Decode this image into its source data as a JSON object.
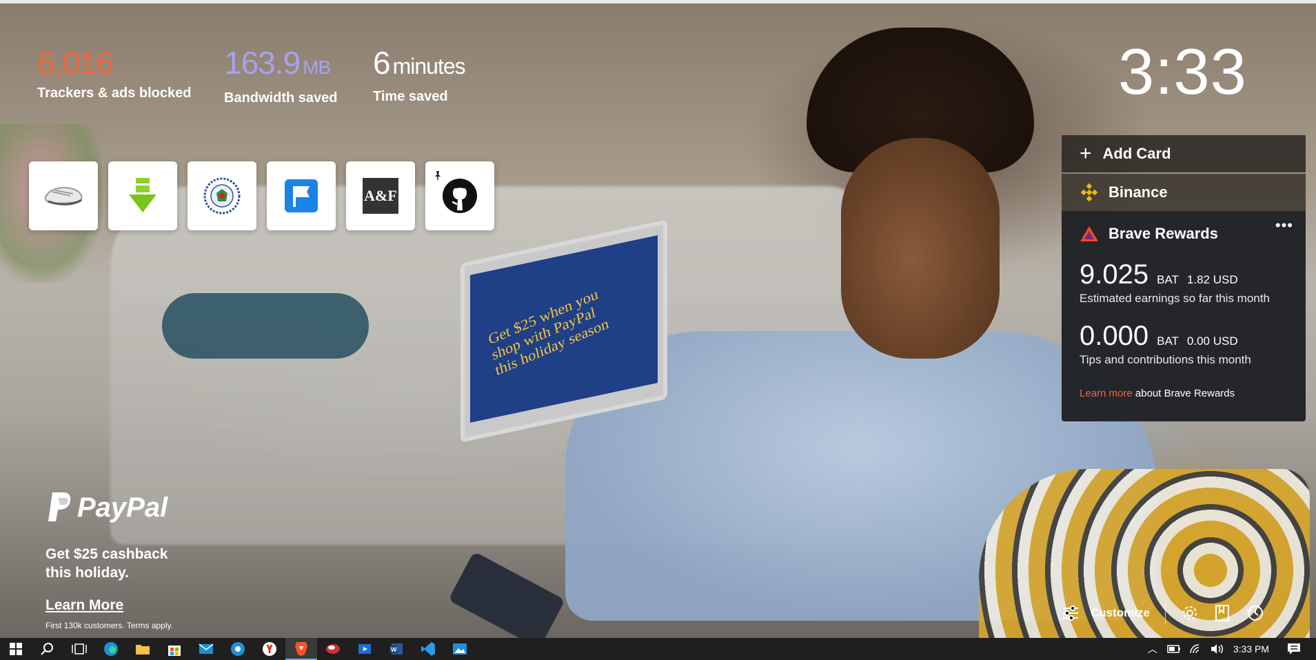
{
  "stats": {
    "trackers_value": "6,016",
    "trackers_label": "Trackers & ads blocked",
    "bandwidth_value": "163.9",
    "bandwidth_unit": "MB",
    "bandwidth_label": "Bandwidth saved",
    "time_value": "6",
    "time_unit": "minutes",
    "time_label": "Time saved"
  },
  "colors": {
    "trackers": "#f2643d",
    "bandwidth": "#a9a1ee",
    "learn_more": "#f2643d",
    "binance": "#f0b90b"
  },
  "top_sites": [
    {
      "icon": "shoe-icon"
    },
    {
      "icon": "download-arrow-icon"
    },
    {
      "icon": "coat-of-arms-icon"
    },
    {
      "icon": "flag-icon"
    },
    {
      "icon": "af-logo-icon",
      "text": "A&F"
    },
    {
      "icon": "github-icon"
    }
  ],
  "clock": "3:33",
  "cards": {
    "add_card": "Add Card",
    "binance": "Binance"
  },
  "rewards": {
    "title": "Brave Rewards",
    "earnings_amount": "9.025",
    "earnings_currency": "BAT",
    "earnings_usd": "1.82 USD",
    "earnings_desc": "Estimated earnings so far this month",
    "tips_amount": "0.000",
    "tips_currency": "BAT",
    "tips_usd": "0.00 USD",
    "tips_desc": "Tips and contributions this month",
    "learn_more": "Learn more",
    "learn_more_suffix": "about Brave Rewards"
  },
  "ad": {
    "brand": "PayPal",
    "headline_line1": "Get $25 cashback",
    "headline_line2": "this holiday.",
    "cta": "Learn More",
    "fineprint": "First 130k customers. Terms apply."
  },
  "photo": {
    "laptop_line1": "Get $25 when you",
    "laptop_line2": "shop with PayPal",
    "laptop_line3": "this holiday season"
  },
  "controls": {
    "customize": "Customize"
  },
  "taskbar": {
    "apps": [
      "windows-start-icon",
      "search-icon",
      "task-view-icon",
      "edge-icon",
      "file-explorer-icon",
      "store-icon",
      "mail-icon",
      "chrome-icon",
      "yandex-icon",
      "brave-icon",
      "network-app-icon",
      "video-app-icon",
      "word-icon",
      "vscode-icon",
      "photos-icon"
    ],
    "time": "3:33 PM"
  }
}
